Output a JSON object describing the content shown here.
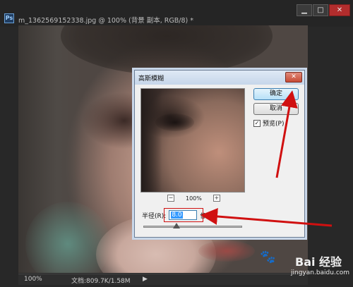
{
  "window": {
    "app_icon": "Ps",
    "title": "m_1362569152338.jpg @ 100% (背景 副本, RGB/8) *",
    "controls": [
      "minimize-icon",
      "maximize-icon",
      "close-icon"
    ]
  },
  "statusbar": {
    "zoom": "100%",
    "doc": "文档:809.7K/1.58M",
    "arrow": "▶"
  },
  "dialog": {
    "title": "高斯模糊",
    "close_glyph": "✕",
    "preview_zoom": "100%",
    "zoom_out": "−",
    "zoom_in": "+",
    "ok_label": "确定",
    "cancel_label": "取消",
    "preview_label": "预览(P)",
    "preview_checked": true,
    "radius_label": "半径(R):",
    "radius_value": "8.0",
    "radius_unit": "像素",
    "slider_fraction": 0.33
  },
  "watermark": {
    "text": "Bai 经验",
    "site": "jingyan.baidu.com"
  },
  "colors": {
    "annotation": "#d01010",
    "dialog_accent": "#3c7fb1"
  }
}
